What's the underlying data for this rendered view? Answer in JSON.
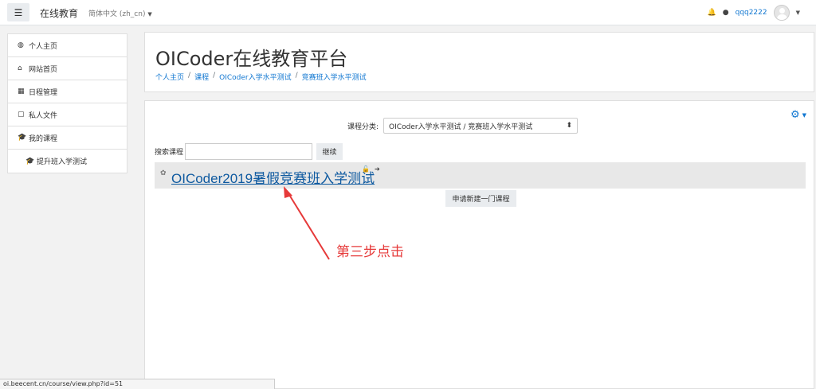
{
  "navbar": {
    "menu_icon": "hamburger-icon",
    "site_name": "在线教育",
    "language": "简体中文 (zh_cn)",
    "username": "qqq2222",
    "bell_icon": "bell-icon",
    "message_icon": "chat-icon"
  },
  "sidebar": {
    "items": [
      {
        "label": "个人主页",
        "icon": "dashboard-icon"
      },
      {
        "label": "网站首页",
        "icon": "home-icon"
      },
      {
        "label": "日程管理",
        "icon": "calendar-icon"
      },
      {
        "label": "私人文件",
        "icon": "file-icon"
      },
      {
        "label": "我的课程",
        "icon": "graduation-cap-icon"
      },
      {
        "label": "提升班入学测试",
        "icon": "graduation-cap-icon"
      }
    ]
  },
  "header": {
    "title": "OICoder在线教育平台",
    "breadcrumb": [
      "个人主页",
      "课程",
      "OICoder入学水平测试",
      "竞赛班入学水平测试"
    ]
  },
  "main": {
    "category_label": "课程分类:",
    "category_value": "OICoder入学水平测试 / 竞赛班入学水平测试",
    "search_label": "搜索课程",
    "search_value": "",
    "search_button": "继续",
    "course_title": "OICoder2019暑假竞赛班入学测试",
    "request_button": "申请新建一门课程"
  },
  "annotation": {
    "text": "第三步点击",
    "color": "#e63a3a"
  },
  "status_url": "oi.beecent.cn/course/view.php?id=51",
  "colors": {
    "link": "#1177d1",
    "course_link": "#0f5aa0"
  }
}
